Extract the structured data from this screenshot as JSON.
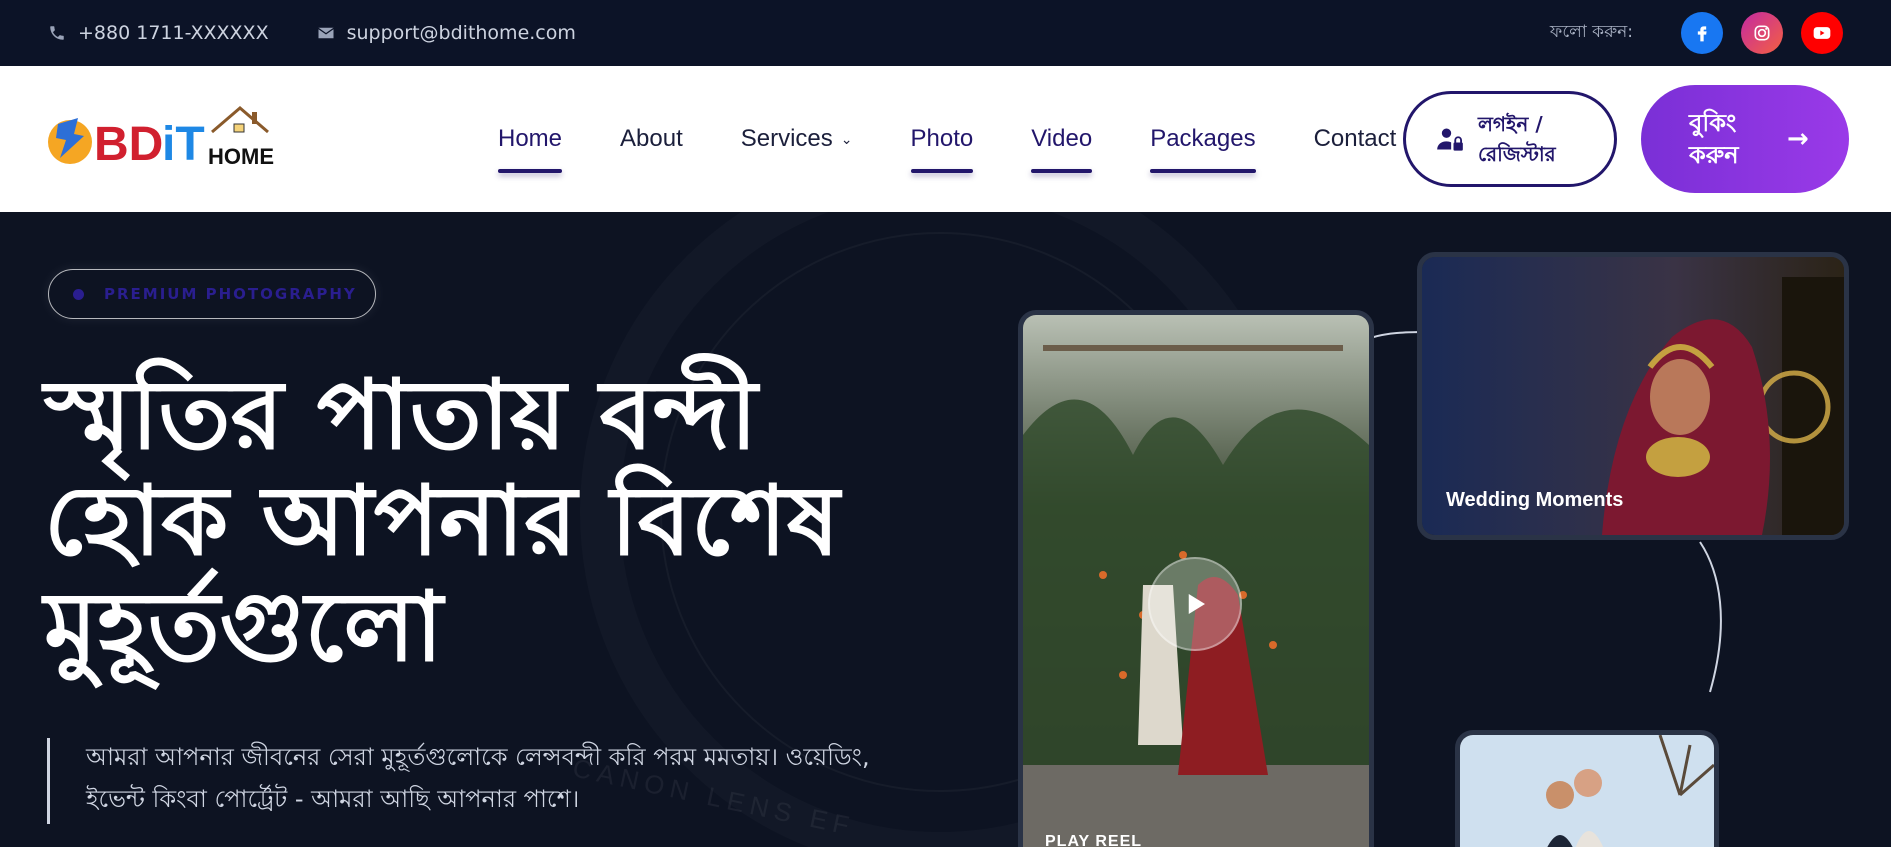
{
  "topbar": {
    "phone": "+880 1711-XXXXXX",
    "email": "support@bdithome.com",
    "follow_label": "ফলো করুন:",
    "socials": [
      {
        "name": "facebook",
        "color": "#1877f2"
      },
      {
        "name": "instagram",
        "color": "#e1306c"
      },
      {
        "name": "youtube",
        "color": "#ff0000"
      }
    ]
  },
  "logo": {
    "text_bd": "BD",
    "text_it": "iT",
    "text_home": "HOME"
  },
  "nav": {
    "items": [
      {
        "label": "Home",
        "active": true
      },
      {
        "label": "About",
        "active": false
      },
      {
        "label": "Services",
        "active": false
      },
      {
        "label": "Photo",
        "active": true
      },
      {
        "label": "Video",
        "active": true
      },
      {
        "label": "Packages",
        "active": true
      },
      {
        "label": "Contact",
        "active": false
      }
    ],
    "login_line1": "লগইন /",
    "login_line2": "রেজিস্টার",
    "booking_label": "বুকিং করুন"
  },
  "hero": {
    "badge": "PREMIUM PHOTOGRAPHY",
    "headline_line1": "স্মৃতির পাতায় বন্দী",
    "headline_line2": "হোক আপনার বিশেষ",
    "headline_line3": "মুহূর্তগুলো",
    "desc_line1": "আমরা আপনার জীবনের সেরা মুহূর্তগুলোকে লেন্সবন্দী করি পরম মমতায়। ওয়েডিং,",
    "desc_line2": "ইভেন্ট কিংবা পোর্ট্রেট - আমরা আছি আপনার পাশে।",
    "bg_text_1": "CANON LENS EF",
    "video_label": "PLAY REEL",
    "wedding_label": "Wedding Moments"
  },
  "colors": {
    "primary": "#22166b",
    "accent": "#8e36e3",
    "dark_bg": "#0d1322"
  }
}
